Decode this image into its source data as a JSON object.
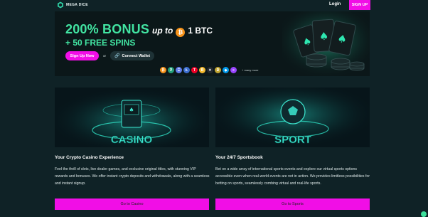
{
  "header": {
    "logo_text": "MEGA DICE",
    "login_label": "Login",
    "signup_label": "SIGN UP"
  },
  "hero": {
    "bonus": "200% BONUS",
    "up_to": "up to",
    "btc_symbol": "₿",
    "btc_amount": "1 BTC",
    "free_spins": "+ 50 FREE SPINS",
    "signup_now": "Sign Up Now",
    "or": "or",
    "connect_wallet": "Connect Wallet",
    "wallet_icon": "🔗",
    "more_label": "+ many more",
    "coins": [
      {
        "name": "btc-coin-icon",
        "glyph": "₿",
        "color": "#f7931a"
      },
      {
        "name": "usdt-coin-icon",
        "glyph": "₮",
        "color": "#26a17b"
      },
      {
        "name": "eth-coin-icon",
        "glyph": "Ξ",
        "color": "#627eea"
      },
      {
        "name": "ltc-coin-icon",
        "glyph": "Ł",
        "color": "#3d6fd1"
      },
      {
        "name": "trx-coin-icon",
        "glyph": "T",
        "color": "#ef0027"
      },
      {
        "name": "bnb-coin-icon",
        "glyph": "B",
        "color": "#f3ba2f"
      },
      {
        "name": "xrp-coin-icon",
        "glyph": "✕",
        "color": "#23292f"
      },
      {
        "name": "doge-coin-icon",
        "glyph": "Ð",
        "color": "#c2a633"
      },
      {
        "name": "ton-coin-icon",
        "glyph": "◆",
        "color": "#0098ea"
      },
      {
        "name": "sol-coin-icon",
        "glyph": "≡",
        "color": "#9945ff"
      }
    ]
  },
  "casino": {
    "title": "Your Crypto Casino Experience",
    "desc": "Feel the thrill of slots, live dealer games, and exclusive original titles, with stunning VIP rewards and bonuses. We offer instant crypto deposits and withdrawals, along with a seamless and instant signup.",
    "button": "Go to Casino",
    "art_text": "CASINO"
  },
  "sports": {
    "title": "Your 24/7 Sportsbook",
    "desc": "Bet on a wide array of international sports events and explore our virtual sports options accessible even when real-world events are not in action. We provides limitless possibilities for betting on sports, seamlessly combing virtual and real-life sports.",
    "button": "Go to Sports",
    "art_text": "SPORT"
  },
  "colors": {
    "accent": "#f10ee6",
    "bonus_green": "#42e4a2",
    "background": "#0f2226"
  }
}
